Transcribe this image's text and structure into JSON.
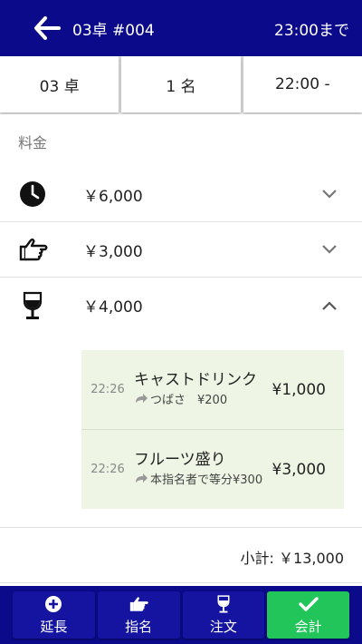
{
  "header": {
    "title": "03卓 #004",
    "until": "23:00まで"
  },
  "segments": {
    "table": "03 卓",
    "guests": "1 名",
    "time": "22:00 -"
  },
  "section": {
    "label": "料金"
  },
  "charges": [
    {
      "icon": "clock-icon",
      "amount": "￥6,000",
      "expanded": false
    },
    {
      "icon": "pointing-hand-icon",
      "amount": "￥3,000",
      "expanded": false
    },
    {
      "icon": "wine-glass-icon",
      "amount": "￥4,000",
      "expanded": true
    }
  ],
  "details": [
    {
      "time": "22:26",
      "name": "キャストドリンク",
      "sub": "つばさ　¥200",
      "price": "¥1,000"
    },
    {
      "time": "22:26",
      "name": "フルーツ盛り",
      "sub": "本指名者で等分¥300",
      "price": "¥3,000"
    }
  ],
  "subtotal": {
    "text": "小計: ￥13,000"
  },
  "tabs": [
    {
      "icon": "plus-circle-icon",
      "label": "延長",
      "active": false
    },
    {
      "icon": "pointing-hand-icon",
      "label": "指名",
      "active": false
    },
    {
      "icon": "wine-glass-icon",
      "label": "注文",
      "active": false
    },
    {
      "icon": "check-icon",
      "label": "会計",
      "active": true
    }
  ],
  "colors": {
    "header": "#0a0a8a",
    "active_tab": "#22c55a",
    "detail_bg": "#eef5e4"
  }
}
